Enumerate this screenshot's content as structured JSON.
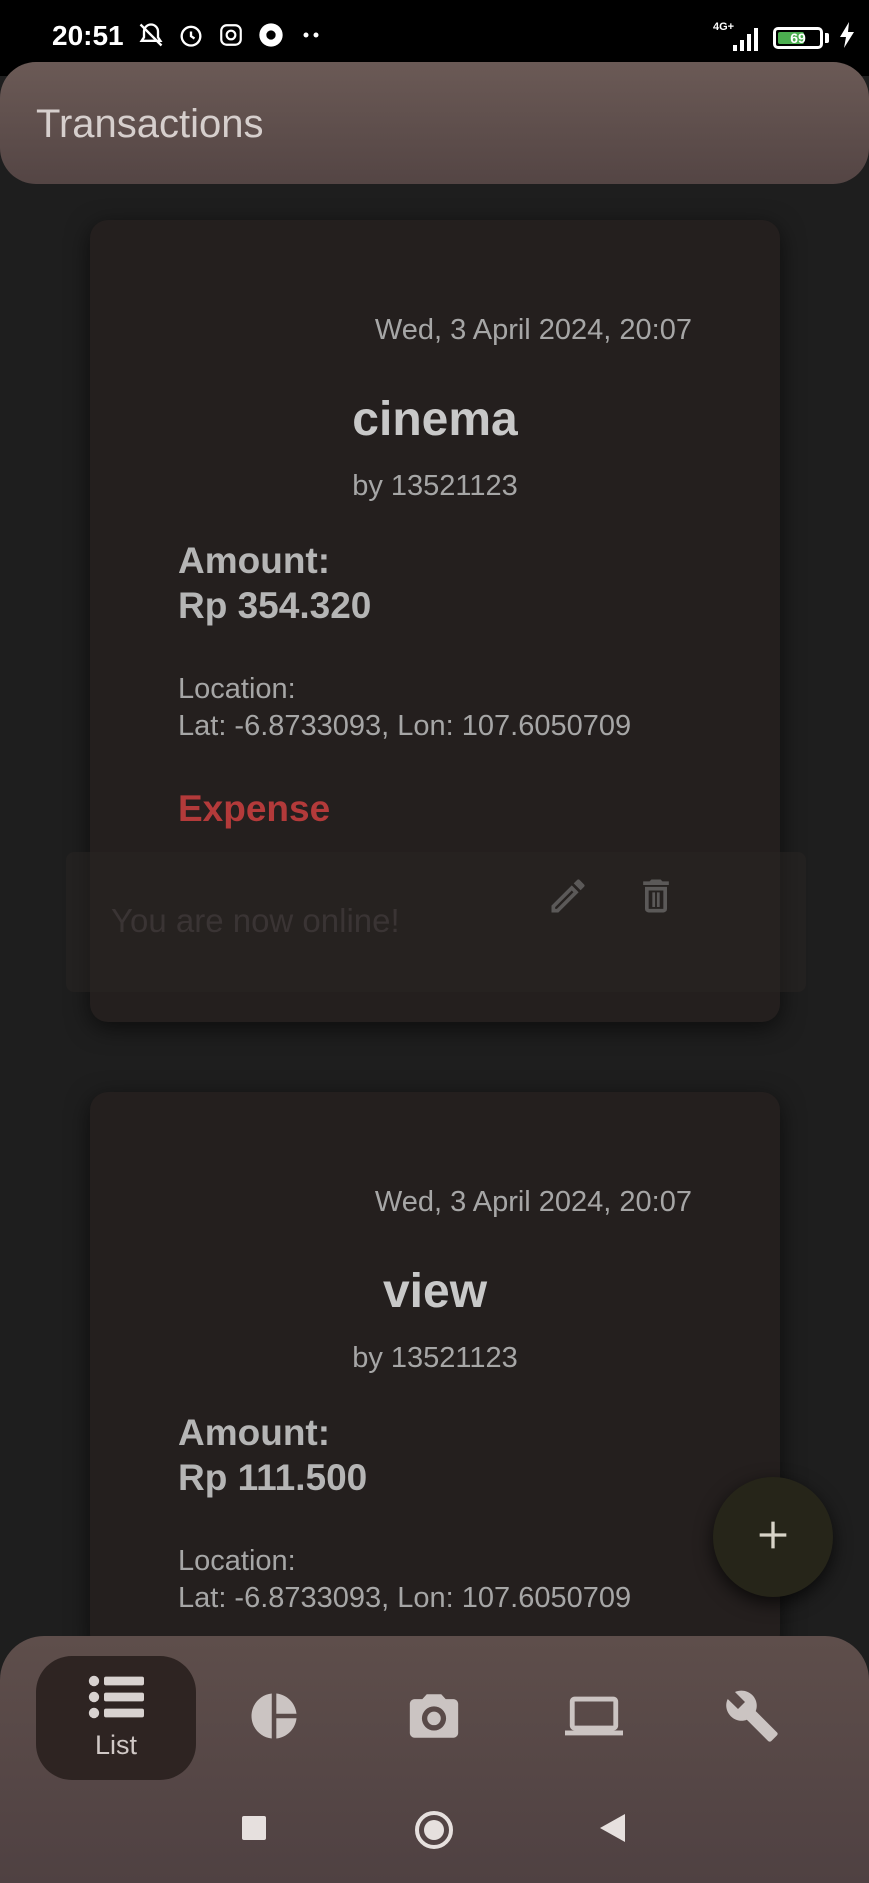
{
  "status_bar": {
    "time": "20:51",
    "network": "4G+",
    "battery_level": "69",
    "battery_fraction": 0.69,
    "icons": [
      "mute-bell-icon",
      "alarm-icon",
      "instagram-icon",
      "ojol-icon",
      "more-dots-icon",
      "signal-icon",
      "battery-icon",
      "charging-icon"
    ]
  },
  "app_bar": {
    "title": "Transactions"
  },
  "transactions": [
    {
      "date": "Wed, 3 April 2024, 20:07",
      "name": "cinema",
      "by": "by 13521123",
      "amount_label": "Amount:",
      "amount": "Rp 354.320",
      "location_label": "Location:",
      "location": "Lat: -6.8733093, Lon: 107.6050709",
      "type": "Expense",
      "type_color": "#b33a3a"
    },
    {
      "date": "Wed, 3 April 2024, 20:07",
      "name": "view",
      "by": "by 13521123",
      "amount_label": "Amount:",
      "amount": "Rp 111.500",
      "location_label": "Location:",
      "location": "Lat: -6.8733093, Lon: 107.6050709"
    }
  ],
  "snackbar": {
    "message": "You are now online!"
  },
  "fab": {
    "icon": "plus-icon"
  },
  "bottom_nav": {
    "items": [
      {
        "label": "List",
        "icon": "list-icon",
        "active": true
      },
      {
        "icon": "pie-chart-icon"
      },
      {
        "icon": "camera-icon"
      },
      {
        "icon": "laptop-icon"
      },
      {
        "icon": "wrench-icon"
      }
    ]
  },
  "system_nav": {
    "icons": [
      "recents-square-icon",
      "home-circle-icon",
      "back-triangle-icon"
    ]
  },
  "colors": {
    "background": "#1e1e1e",
    "app_bar": "#6b5a56",
    "card": "#241f1e",
    "expense": "#b33a3a",
    "fab": "#262519"
  }
}
